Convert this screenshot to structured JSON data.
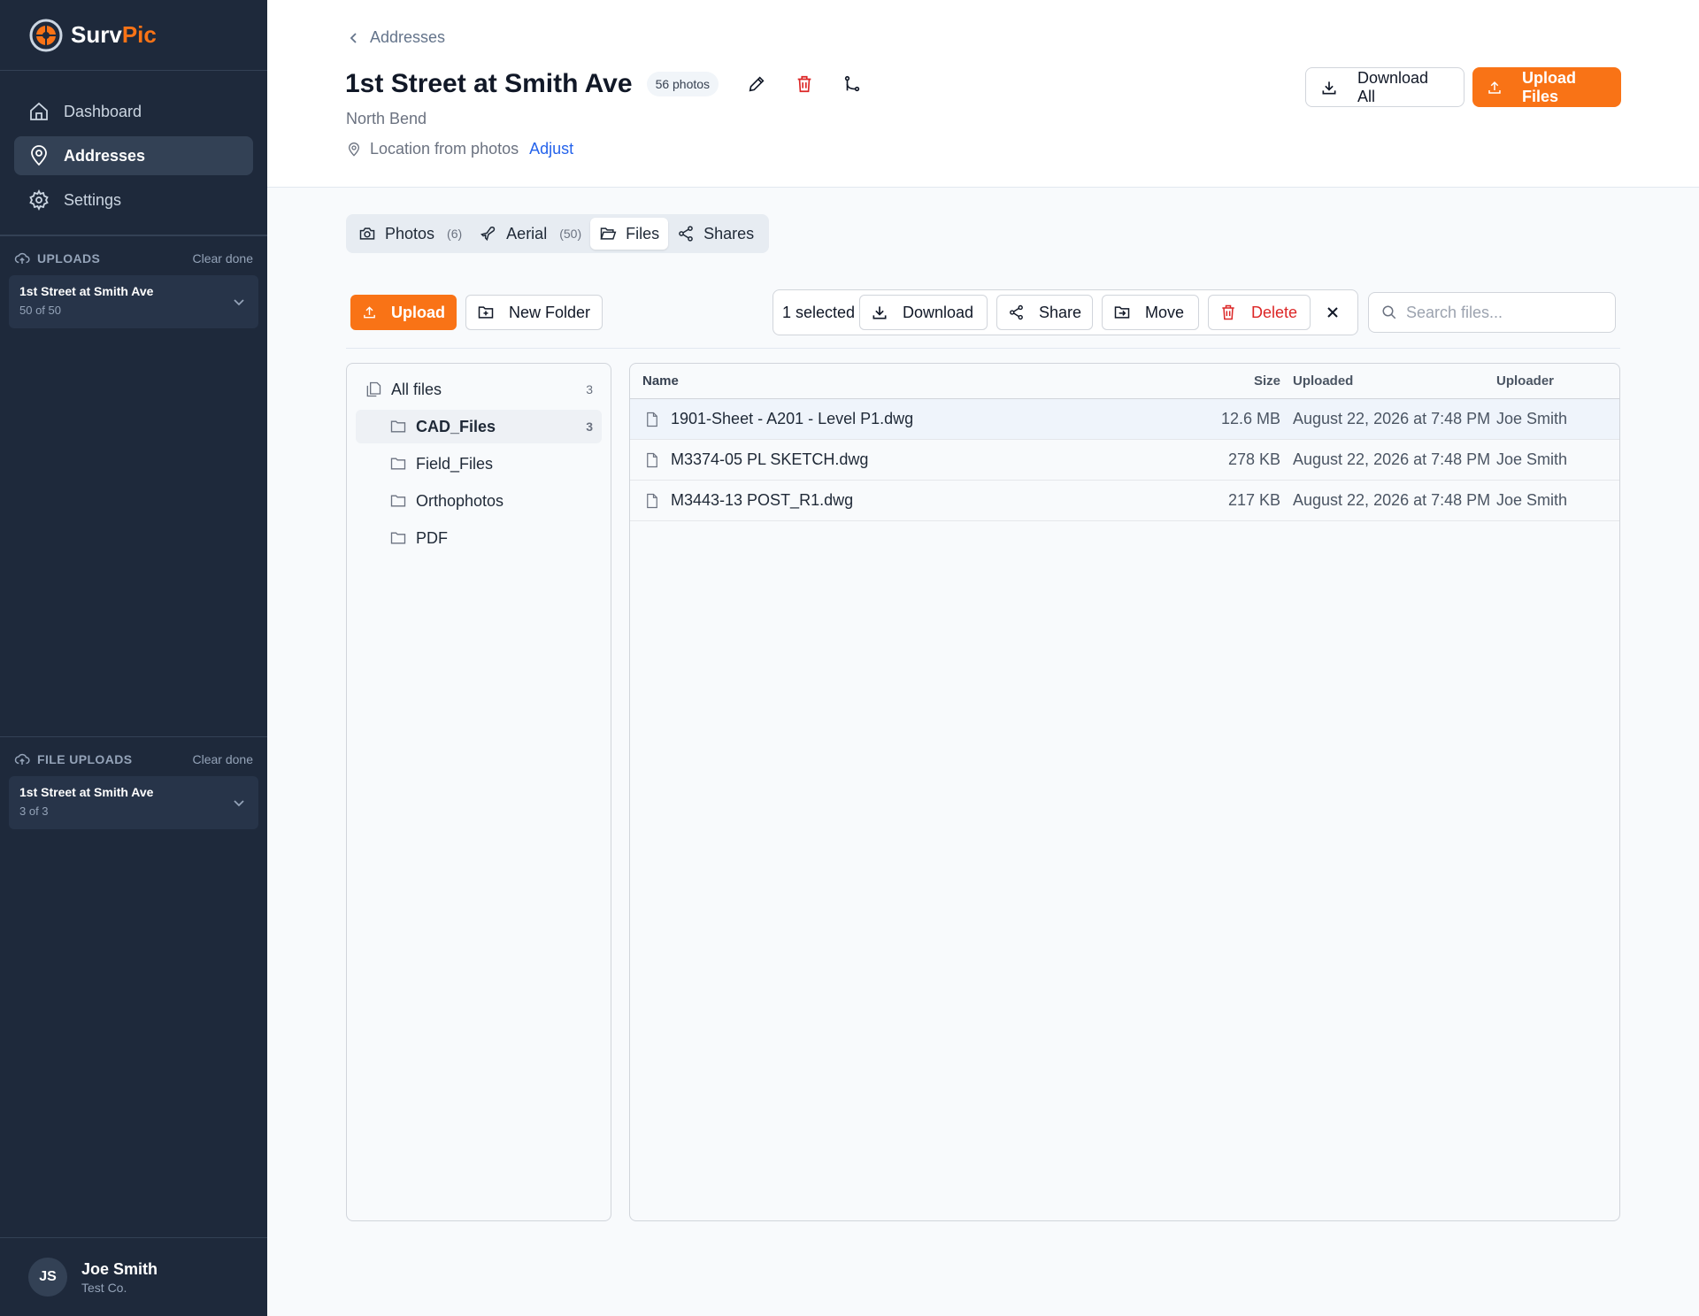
{
  "brand": {
    "name_main": "Surv",
    "name_accent": "Pic",
    "accent_color": "#f97316"
  },
  "nav": [
    {
      "label": "Dashboard",
      "icon": "home-icon"
    },
    {
      "label": "Addresses",
      "icon": "map-pin-icon",
      "active": true
    },
    {
      "label": "Settings",
      "icon": "gear-icon"
    }
  ],
  "uploads": {
    "title": "UPLOADS",
    "clear": "Clear done",
    "item": {
      "name": "1st Street at Smith Ave",
      "status": "50 of 50"
    }
  },
  "file_uploads": {
    "title": "FILE UPLOADS",
    "clear": "Clear done",
    "item": {
      "name": "1st Street at Smith Ave",
      "status": "3 of 3"
    }
  },
  "user": {
    "initials": "JS",
    "name": "Joe Smith",
    "company": "Test Co."
  },
  "header": {
    "breadcrumb": "Addresses",
    "title": "1st Street at Smith Ave",
    "badge": "56 photos",
    "subtitle": "North Bend",
    "location_text": "Location from photos",
    "adjust": "Adjust",
    "download_all": "Download All",
    "upload_files": "Upload Files"
  },
  "tabs": [
    {
      "label": "Photos",
      "count": "(6)",
      "icon": "camera-icon"
    },
    {
      "label": "Aerial",
      "count": "(50)",
      "icon": "plane-icon"
    },
    {
      "label": "Files",
      "count": "",
      "icon": "folder-open-icon",
      "active": true
    },
    {
      "label": "Shares",
      "count": "",
      "icon": "share-icon"
    }
  ],
  "toolbar": {
    "upload": "Upload",
    "new_folder": "New Folder",
    "selected": "1 selected",
    "download": "Download",
    "share": "Share",
    "move": "Move",
    "delete": "Delete",
    "search_placeholder": "Search files..."
  },
  "tree": {
    "all": {
      "label": "All files",
      "count": "3"
    },
    "folders": [
      {
        "label": "CAD_Files",
        "count": "3",
        "active": true
      },
      {
        "label": "Field_Files",
        "count": ""
      },
      {
        "label": "Orthophotos",
        "count": ""
      },
      {
        "label": "PDF",
        "count": ""
      }
    ]
  },
  "table": {
    "headers": {
      "name": "Name",
      "size": "Size",
      "uploaded": "Uploaded",
      "uploader": "Uploader"
    },
    "rows": [
      {
        "name": "1901-Sheet - A201 - Level P1.dwg",
        "size": "12.6 MB",
        "uploaded": "August 22, 2026 at 7:48 PM",
        "uploader": "Joe Smith",
        "selected": true
      },
      {
        "name": "M3374-05 PL SKETCH.dwg",
        "size": "278 KB",
        "uploaded": "August 22, 2026 at 7:48 PM",
        "uploader": "Joe Smith"
      },
      {
        "name": "M3443-13 POST_R1.dwg",
        "size": "217 KB",
        "uploaded": "August 22, 2026 at 7:48 PM",
        "uploader": "Joe Smith"
      }
    ]
  }
}
